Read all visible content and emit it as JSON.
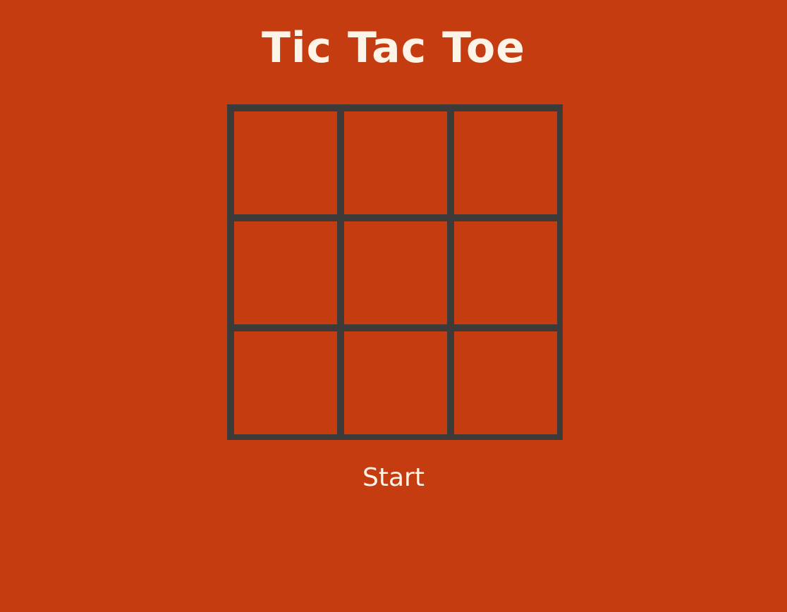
{
  "game": {
    "title": "Tic Tac Toe",
    "start_label": "Start",
    "board": [
      [
        "",
        "",
        ""
      ],
      [
        "",
        "",
        ""
      ],
      [
        "",
        "",
        ""
      ]
    ]
  },
  "colors": {
    "background": "#c43c0f",
    "grid_lines": "#3d3b3a",
    "text": "#fdf3e7"
  }
}
